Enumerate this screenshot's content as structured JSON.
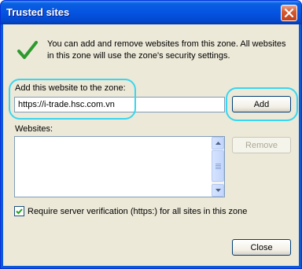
{
  "title": "Trusted sites",
  "info_text": "You can add and remove websites from this zone. All websites in this zone will use the zone's security settings.",
  "add_label": "Add this website to the zone:",
  "url_value": "https://i-trade.hsc.com.vn",
  "add_button": "Add",
  "websites_label": "Websites:",
  "remove_button": "Remove",
  "require_https_label": "Require server verification (https:) for all sites in this zone",
  "require_https_checked": true,
  "close_button": "Close",
  "colors": {
    "highlight": "#38d6f0",
    "title_bar": "#0554e2",
    "check": "#2e9a2e"
  }
}
